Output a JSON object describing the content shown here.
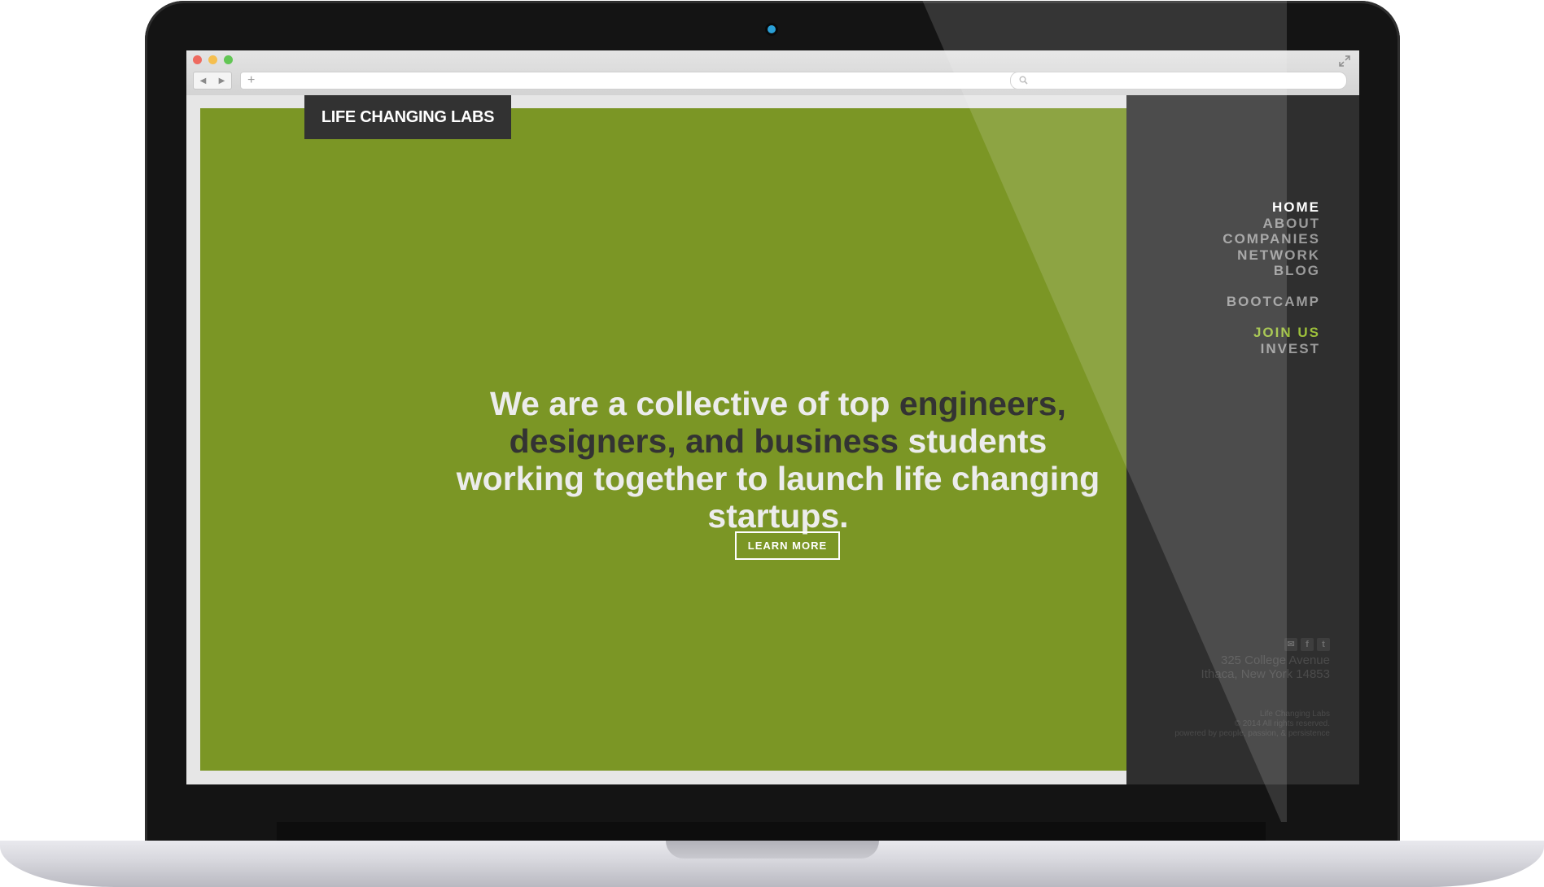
{
  "site": {
    "logo": "LIFE CHANGING LABS",
    "headline": {
      "part1": "We are a collective of top ",
      "highlight": "engineers, designers, and business",
      "part2": " students working together to launch life changing startups."
    },
    "cta_label": "LEARN MORE"
  },
  "nav": {
    "primary": [
      "HOME",
      "ABOUT",
      "COMPANIES",
      "NETWORK",
      "BLOG"
    ],
    "bootcamp": "BOOTCAMP",
    "join_us": "JOIN US",
    "invest": "INVEST"
  },
  "contact": {
    "address_line1": "325 College Avenue",
    "address_line2": "Ithaca, New York 14853",
    "social_icons": [
      "mail-icon",
      "facebook-icon",
      "twitter-icon"
    ]
  },
  "footer": {
    "line1": "Life Changing Labs",
    "line2": "© 2014 All rights reserved.",
    "line3": "powered by people, passion, & persistence"
  },
  "colors": {
    "brand_green": "#7b9625",
    "accent_join": "#9dc03b",
    "sidebar": "#2f2f2f",
    "logo_bg": "#323232",
    "headline_highlight": "#333333"
  }
}
